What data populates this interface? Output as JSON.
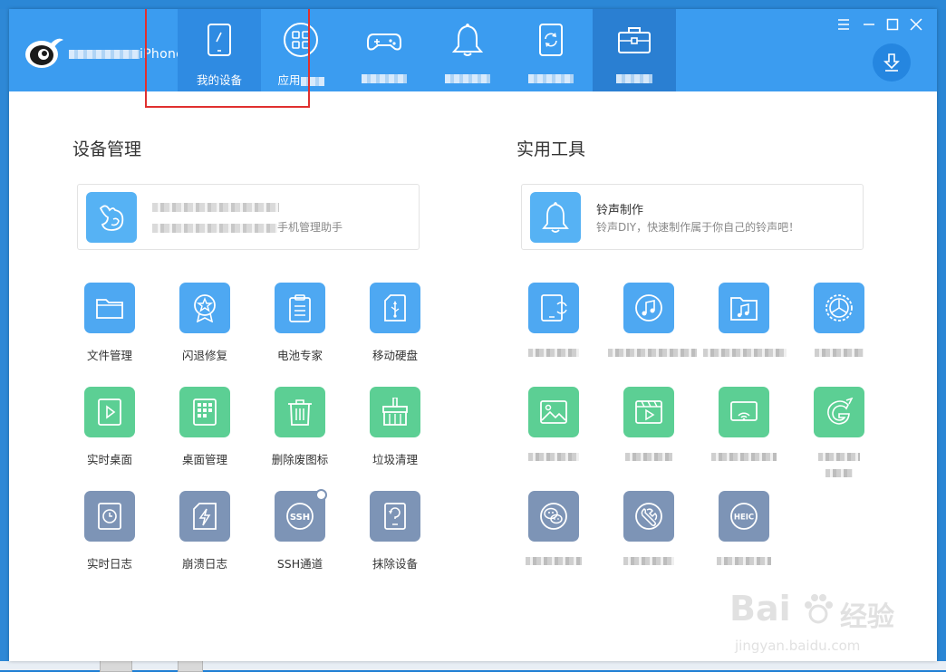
{
  "window": {
    "device_name": "iPhone",
    "nav_tabs": [
      {
        "id": "my-device",
        "label": "我的设备",
        "icon": "tablet-icon"
      },
      {
        "id": "apps",
        "label": "应用",
        "icon": "apps-grid-icon"
      },
      {
        "id": "games",
        "label": "",
        "icon": "gamepad-icon"
      },
      {
        "id": "ringtones",
        "label": "",
        "icon": "bell-icon"
      },
      {
        "id": "flash",
        "label": "",
        "icon": "tablet-sync-icon"
      },
      {
        "id": "toolbox",
        "label": "",
        "icon": "toolbox-icon"
      }
    ]
  },
  "left_section": {
    "title": "设备管理",
    "card": {
      "title": "",
      "desc": "手机管理助手",
      "icon": "rabbit-icon"
    },
    "tools": [
      {
        "label": "文件管理",
        "icon": "folder-icon",
        "color": "blue"
      },
      {
        "label": "闪退修复",
        "icon": "badge-star-icon",
        "color": "blue"
      },
      {
        "label": "电池专家",
        "icon": "clipboard-icon",
        "color": "blue"
      },
      {
        "label": "移动硬盘",
        "icon": "usb-card-icon",
        "color": "blue"
      },
      {
        "label": "实时桌面",
        "icon": "play-screen-icon",
        "color": "green"
      },
      {
        "label": "桌面管理",
        "icon": "grid-phone-icon",
        "color": "green"
      },
      {
        "label": "删除废图标",
        "icon": "trash-icon",
        "color": "green"
      },
      {
        "label": "垃圾清理",
        "icon": "broom-icon",
        "color": "green"
      },
      {
        "label": "实时日志",
        "icon": "clock-doc-icon",
        "color": "slate"
      },
      {
        "label": "崩溃日志",
        "icon": "bolt-doc-icon",
        "color": "slate"
      },
      {
        "label": "SSH通道",
        "icon": "ssh-icon",
        "color": "slate"
      },
      {
        "label": "抹除设备",
        "icon": "erase-phone-icon",
        "color": "slate"
      }
    ]
  },
  "right_section": {
    "title": "实用工具",
    "card": {
      "title": "铃声制作",
      "desc": "铃声DIY，快速制作属于你自己的铃声吧！",
      "icon": "bell-icon"
    },
    "tools": [
      {
        "icon": "tablet-refresh-icon",
        "color": "blue"
      },
      {
        "icon": "music-disc-icon",
        "color": "blue"
      },
      {
        "icon": "music-folder-icon",
        "color": "blue"
      },
      {
        "icon": "gear-wheel-icon",
        "color": "blue"
      },
      {
        "icon": "image-icon",
        "color": "green"
      },
      {
        "icon": "video-clapper-icon",
        "color": "green"
      },
      {
        "icon": "airplay-icon",
        "color": "green"
      },
      {
        "icon": "swirl-g-icon",
        "color": "green"
      },
      {
        "icon": "wechat-icon",
        "color": "slate"
      },
      {
        "icon": "wrench-icon",
        "color": "slate"
      },
      {
        "icon": "heic-icon",
        "color": "slate",
        "icon_text": "HEIC"
      }
    ]
  },
  "ssh_icon_text": "SSH",
  "watermark": {
    "brand": "Bai",
    "brand2": "经验",
    "url": "jingyan.baidu.com"
  }
}
